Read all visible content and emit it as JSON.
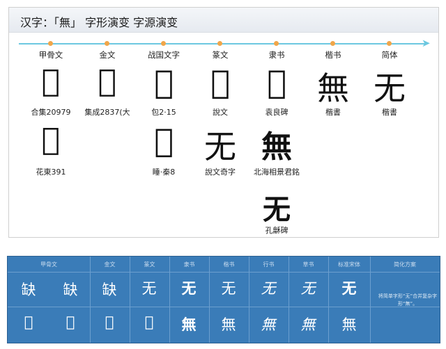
{
  "title": "汉字：「無」 字形演变 字源演变",
  "columns": [
    {
      "header": "甲骨文",
      "glyphs": [
        {
          "char": "𣞤",
          "caption": "合集20979"
        },
        {
          "char": "𣞤",
          "caption": "花東391"
        }
      ]
    },
    {
      "header": "金文",
      "glyphs": [
        {
          "char": "𣞤",
          "caption": "集成2837(大"
        }
      ]
    },
    {
      "header": "战国文字",
      "glyphs": [
        {
          "char": "𣞤",
          "caption": "包2·15"
        },
        {
          "char": "𣞤",
          "caption": "睡·秦8"
        }
      ]
    },
    {
      "header": "篆文",
      "glyphs": [
        {
          "char": "𣞤",
          "caption": "說文"
        },
        {
          "char": "无",
          "caption": "說文奇字"
        }
      ]
    },
    {
      "header": "隶书",
      "glyphs": [
        {
          "char": "𣞤",
          "caption": "袁良碑"
        },
        {
          "char": "無",
          "caption": "北海相景君銘"
        },
        {
          "char": "无",
          "caption": "孔龢碑"
        }
      ]
    },
    {
      "header": "楷书",
      "glyphs": [
        {
          "char": "無",
          "caption": "楷書"
        }
      ]
    },
    {
      "header": "简体",
      "glyphs": [
        {
          "char": "无",
          "caption": "楷書"
        }
      ]
    }
  ],
  "table": {
    "headers": [
      "甲骨文",
      "金文",
      "篆文",
      "隶书",
      "楷书",
      "行书",
      "草书",
      "标准宋体",
      "简化方案"
    ],
    "row1": [
      "缺",
      "缺",
      "缺",
      "无",
      "无",
      "无",
      "无",
      "无",
      "无"
    ],
    "row2": [
      "𣞤",
      "𣞤",
      "𣞤",
      "𣞤",
      "無",
      "無",
      "無",
      "無",
      "無"
    ],
    "note": "将简单字形“无”合并复杂字形“無”。"
  }
}
